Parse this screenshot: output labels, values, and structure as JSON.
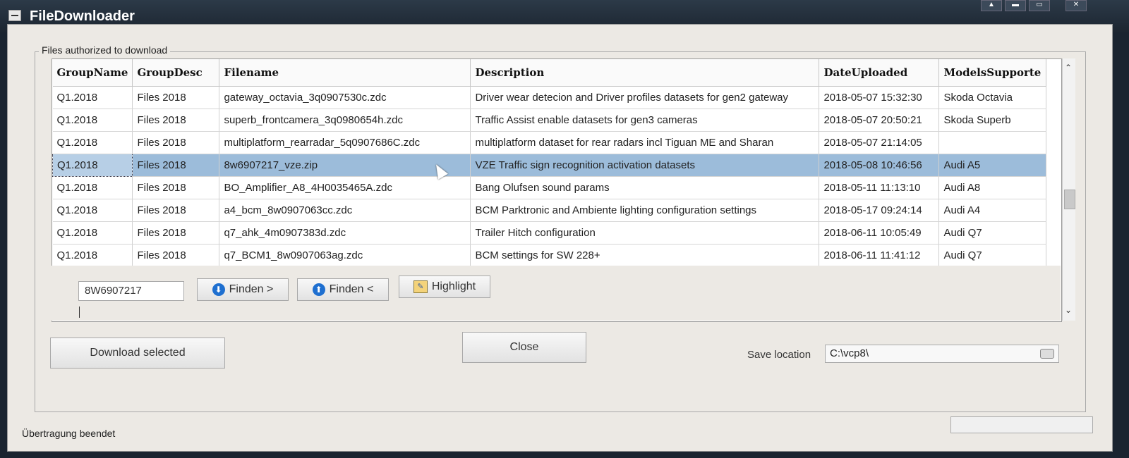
{
  "window": {
    "title": "FileDownloader"
  },
  "group": {
    "label": "Files authorized to download"
  },
  "table": {
    "columns": [
      "GroupName",
      "GroupDesc",
      "Filename",
      "Description",
      "DateUploaded",
      "ModelsSupporte"
    ],
    "rows": [
      [
        "Q1.2018",
        "Files 2018",
        "gateway_octavia_3q0907530c.zdc",
        "Driver wear detecion and Driver profiles datasets for gen2 gateway",
        "2018-05-07 15:32:30",
        "Skoda Octavia"
      ],
      [
        "Q1.2018",
        "Files 2018",
        "superb_frontcamera_3q0980654h.zdc",
        "Traffic Assist enable datasets for gen3 cameras",
        "2018-05-07 20:50:21",
        "Skoda Superb"
      ],
      [
        "Q1.2018",
        "Files 2018",
        "multiplatform_rearradar_5q0907686C.zdc",
        "multiplatform dataset for rear radars incl Tiguan ME and Sharan",
        "2018-05-07 21:14:05",
        ""
      ],
      [
        "Q1.2018",
        "Files 2018",
        "8w6907217_vze.zip",
        "VZE Traffic sign recognition activation datasets",
        "2018-05-08 10:46:56",
        "Audi A5"
      ],
      [
        "Q1.2018",
        "Files 2018",
        "BO_Amplifier_A8_4H0035465A.zdc",
        "Bang Olufsen sound params",
        "2018-05-11 11:13:10",
        "Audi A8"
      ],
      [
        "Q1.2018",
        "Files 2018",
        "a4_bcm_8w0907063cc.zdc",
        "BCM Parktronic and Ambiente lighting configuration settings",
        "2018-05-17 09:24:14",
        "Audi A4"
      ],
      [
        "Q1.2018",
        "Files 2018",
        "q7_ahk_4m0907383d.zdc",
        "Trailer Hitch configuration",
        "2018-06-11 10:05:49",
        "Audi Q7"
      ],
      [
        "Q1.2018",
        "Files 2018",
        "q7_BCM1_8w0907063ag.zdc",
        "BCM settings for SW 228+",
        "2018-06-11 11:41:12",
        "Audi Q7"
      ]
    ],
    "selected_row": 3
  },
  "search": {
    "value": "8W6907217",
    "find_next_label": "Finden >",
    "find_prev_label": "Finden <",
    "highlight_label": "Highlight"
  },
  "buttons": {
    "download_label": "Download selected",
    "close_label": "Close"
  },
  "save": {
    "label": "Save location",
    "value": "C:\\vcp8\\"
  },
  "status": {
    "text": "Übertragung beendet"
  }
}
